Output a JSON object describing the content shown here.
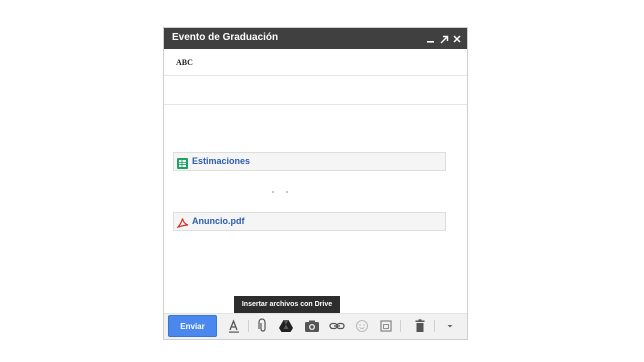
{
  "compose": {
    "title": "Evento de Graduación",
    "to_chip": "ABC",
    "subject": ""
  },
  "attachments": [
    {
      "label": "Estimaciones",
      "icon": "spreadsheet-icon",
      "color": "#1ea362"
    },
    {
      "label": "Anuncio.pdf",
      "icon": "pdf-icon",
      "color": "#d93025"
    }
  ],
  "toolbar": {
    "send_label": "Enviar",
    "tooltip": "Insertar archivos con Drive",
    "icons": [
      "formatting-icon",
      "attach-icon",
      "drive-icon",
      "camera-icon",
      "link-icon",
      "emoji-icon",
      "calendar-icon",
      "trash-icon",
      "more-options-icon"
    ]
  },
  "colors": {
    "titlebar": "#404040",
    "send_button": "#4a88ee",
    "link_text": "#2a5db0"
  }
}
